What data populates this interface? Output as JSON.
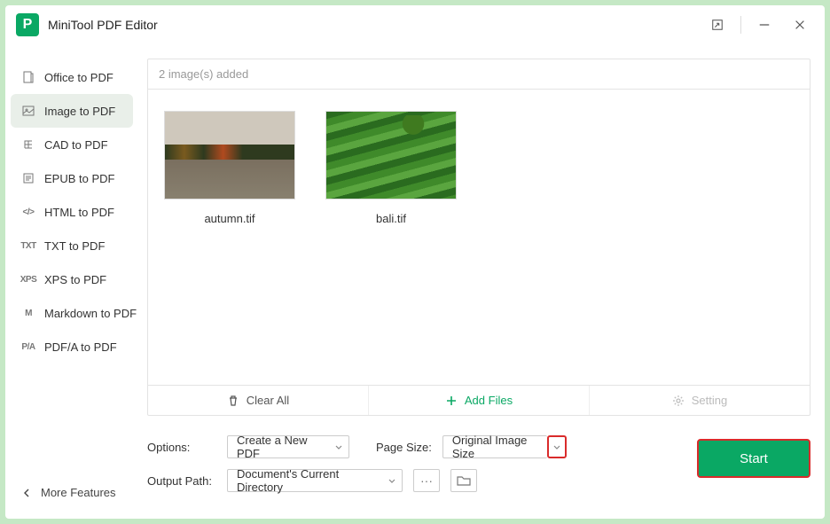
{
  "app": {
    "title": "MiniTool PDF Editor",
    "logo_letter": "P"
  },
  "sidebar": {
    "items": [
      {
        "label": "Office to PDF",
        "icon": "office"
      },
      {
        "label": "Image to PDF",
        "icon": "image",
        "active": true
      },
      {
        "label": "CAD to PDF",
        "icon": "cad"
      },
      {
        "label": "EPUB to PDF",
        "icon": "epub"
      },
      {
        "label": "HTML to PDF",
        "icon": "html"
      },
      {
        "label": "TXT to PDF",
        "icon": "txt"
      },
      {
        "label": "XPS to PDF",
        "icon": "xps"
      },
      {
        "label": "Markdown to PDF",
        "icon": "markdown"
      },
      {
        "label": "PDF/A to PDF",
        "icon": "pdfa"
      }
    ],
    "more": "More Features"
  },
  "content": {
    "status": "2 image(s) added",
    "files": [
      {
        "name": "autumn.tif"
      },
      {
        "name": "bali.tif"
      }
    ]
  },
  "actions": {
    "clear": "Clear All",
    "add": "Add Files",
    "setting": "Setting"
  },
  "controls": {
    "options_label": "Options:",
    "options_value": "Create a New PDF",
    "pagesize_label": "Page Size:",
    "pagesize_value": "Original Image Size",
    "output_label": "Output Path:",
    "output_value": "Document's Current Directory",
    "more": "···",
    "start": "Start"
  }
}
